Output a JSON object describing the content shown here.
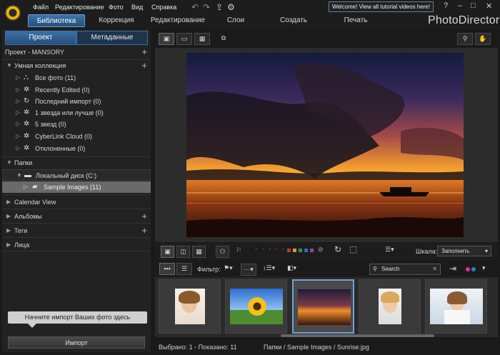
{
  "menu": [
    "Файл",
    "Редактирование",
    "Фото",
    "Вид",
    "Справка"
  ],
  "welcome": "Welcome! View all tutorial videos here!",
  "window_controls": [
    "?",
    "–",
    "□",
    "✕"
  ],
  "modules": [
    "Библиотека",
    "Коррекция",
    "Редактирование",
    "Слои",
    "Создать",
    "Печать"
  ],
  "brand": "PhotoDirector",
  "left_tabs": [
    "Проект",
    "Метаданные"
  ],
  "project_title": "Проект - MANSORY",
  "smart_collection": {
    "title": "Умная коллекция",
    "items": [
      "Все фото (11)",
      "Recently Edited (0)",
      "Последний импорт (0)",
      "1 звезда или лучше (0)",
      "5 звезд (0)",
      "CyberLink Cloud (0)",
      "Отклоненные (0)"
    ]
  },
  "folders": {
    "title": "Папки",
    "items": [
      "Локальный диск (C:)",
      "Sample Images (11)"
    ]
  },
  "sections": [
    "Calendar View",
    "Альбомы",
    "Теги",
    "Лица"
  ],
  "import_hint": "Начните импорт Ваших фото здесь",
  "import_button": "Импорт",
  "zoom_label": "Шкала:",
  "zoom_value": "Заполнить",
  "filter_label": "Фильтр:",
  "search_placeholder": "Search",
  "status": {
    "selected": "Выбрано: 1 - Показано: 11",
    "path": "Папки / Sample Images / Sunrise.jpg"
  },
  "colors": {
    "accent": "#2e5f92",
    "label_colors": [
      "#c0392b",
      "#c9a227",
      "#2e8b57",
      "#2f6fb5",
      "#8e44ad"
    ]
  }
}
